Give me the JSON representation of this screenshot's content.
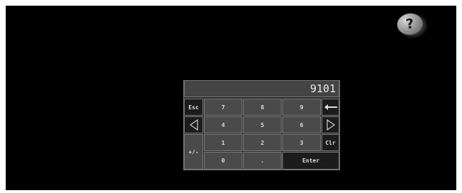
{
  "display": {
    "value": "9101"
  },
  "help": {
    "label": "?"
  },
  "keys": {
    "esc": "Esc",
    "k7": "7",
    "k8": "8",
    "k9": "9",
    "k4": "4",
    "k5": "5",
    "k6": "6",
    "k1": "1",
    "k2": "2",
    "k3": "3",
    "k0": "0",
    "dot": ".",
    "plusminus": "+/-",
    "clr": "Clr",
    "enter": "Enter"
  },
  "icons": {
    "backspace": "left-arrow-icon",
    "left": "left-triangle-icon",
    "right": "right-triangle-icon"
  }
}
